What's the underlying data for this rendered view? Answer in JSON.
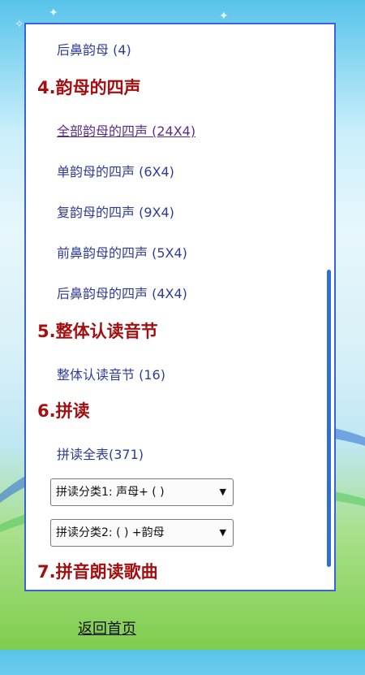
{
  "content": {
    "item_back_nasal": "后鼻韵母 (4)",
    "section4": {
      "heading": "4.韵母的四声",
      "links": [
        "全部韵母的四声 (24X4)",
        "单韵母的四声 (6X4)",
        "复韵母的四声 (9X4)",
        "前鼻韵母的四声 (5X4)",
        "后鼻韵母的四声 (4X4)"
      ]
    },
    "section5": {
      "heading": "5.整体认读音节",
      "link": "整体认读音节 (16)"
    },
    "section6": {
      "heading": "6.拼读",
      "link": "拼读全表(371)",
      "select1": "拼读分类1: 声母+ ( )",
      "select2": "拼读分类2: ( ) +韵母"
    },
    "section7": {
      "heading": "7.拼音朗读歌曲"
    }
  },
  "footer": {
    "home_link": "返回首页"
  },
  "icons": {
    "dropdown": "triangle-down-icon"
  },
  "colors": {
    "heading": "#a50e0e",
    "link": "#2f3b9b",
    "panel_border": "#3b62d6"
  }
}
